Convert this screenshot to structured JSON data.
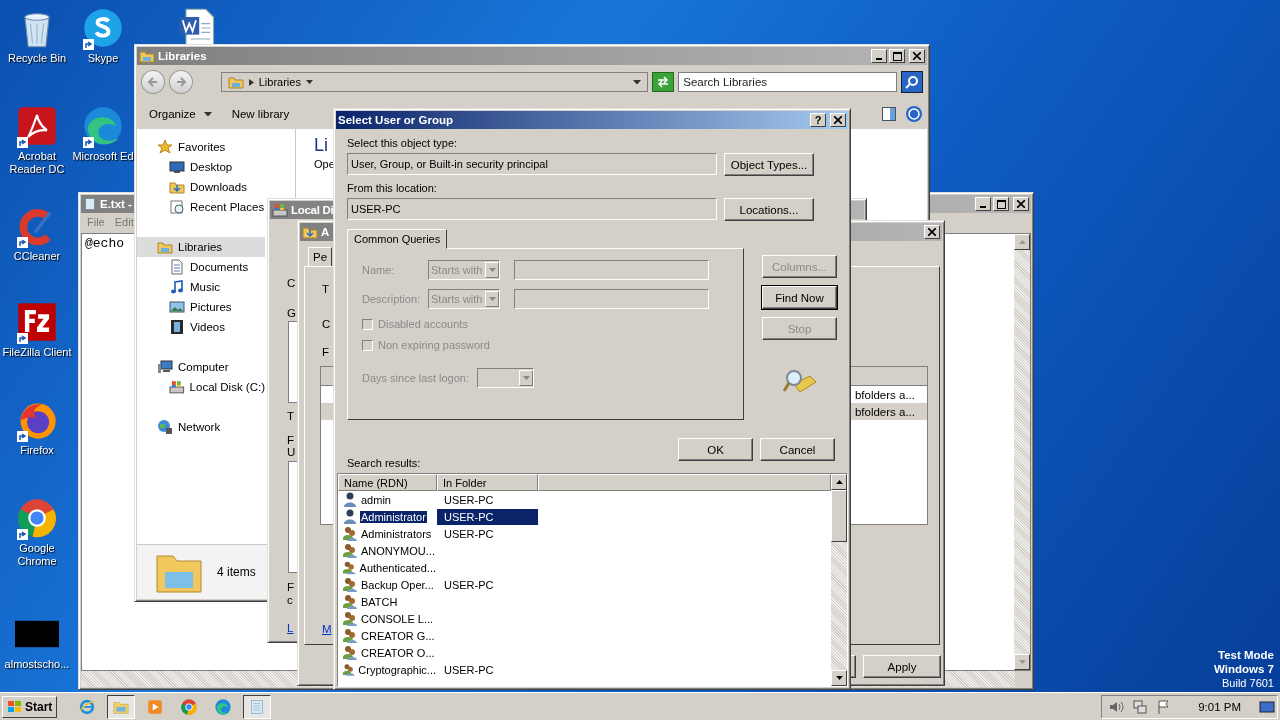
{
  "desktop_icons": [
    {
      "kind": "recycle",
      "label": "Recycle Bin",
      "shortcut": false
    },
    {
      "kind": "skype",
      "label": "Skype",
      "shortcut": true
    },
    {
      "kind": "word",
      "shortcut": false
    },
    {
      "kind": "acrobat",
      "label": "Acrobat Reader DC",
      "shortcut": true
    },
    {
      "kind": "edge",
      "label": "Microsoft Ed",
      "shortcut": true
    },
    {
      "kind": "ccleaner",
      "label": "CCleaner",
      "shortcut": true
    },
    {
      "kind": "filezilla",
      "label": "FileZilla Client",
      "shortcut": true
    },
    {
      "kind": "firefox",
      "label": "Firefox",
      "shortcut": true
    },
    {
      "kind": "chrome",
      "label": "Google Chrome",
      "shortcut": true
    },
    {
      "kind": "thumb",
      "label": "almostscho...",
      "shortcut": false
    }
  ],
  "notepad": {
    "title": "E.txt -",
    "menu": [
      "File",
      "Edit"
    ],
    "text": "@echo"
  },
  "explorer": {
    "title": "Libraries",
    "breadcrumb": "Libraries",
    "search": {
      "placeholder": "Search Libraries"
    },
    "toolbar": [
      {
        "label": "Organize",
        "dropdown": true
      },
      {
        "label": "New library",
        "dropdown": false
      }
    ],
    "nav": [
      {
        "label": "Favorites",
        "kind": "star",
        "selected": false,
        "children": [
          {
            "label": "Desktop",
            "kind": "desktop",
            "selected": false
          },
          {
            "label": "Downloads",
            "kind": "downloads",
            "selected": false
          },
          {
            "label": "Recent Places",
            "kind": "recent",
            "selected": false
          }
        ]
      },
      {
        "label": "Libraries",
        "kind": "library",
        "selected": true,
        "children": [
          {
            "label": "Documents",
            "kind": "document",
            "selected": false
          },
          {
            "label": "Music",
            "kind": "music",
            "selected": false
          },
          {
            "label": "Pictures",
            "kind": "pictures",
            "selected": false
          },
          {
            "label": "Videos",
            "kind": "videos",
            "selected": false
          }
        ]
      },
      {
        "label": "Computer",
        "kind": "computer",
        "selected": false,
        "children": [
          {
            "label": "Local Disk (C:)",
            "kind": "disk",
            "selected": false
          }
        ]
      },
      {
        "label": "Network",
        "kind": "network",
        "selected": false
      }
    ],
    "heading": "Li",
    "subheading": "Ope",
    "status": "4 items"
  },
  "local_disk_window": {
    "title": "Local Di",
    "fragments": [
      "C",
      "G",
      "T",
      "F",
      "U",
      "F",
      "c",
      "L"
    ]
  },
  "security_window": {
    "title": "A",
    "tab": "Pe",
    "fragments": [
      "T",
      "C",
      "F",
      "M"
    ],
    "list_rows": [
      {
        "text": "bfolders a...",
        "selected": false
      },
      {
        "text": "bfolders a...",
        "selected": true
      }
    ],
    "apply": "Apply"
  },
  "dialog": {
    "title": "Select User or Group",
    "help": "?",
    "object_type_label": "Select this object type:",
    "object_type": "User, Group, or Built-in security principal",
    "object_types_button": "Object Types...",
    "location_label": "From this location:",
    "location": "USER-PC",
    "locations_button": "Locations...",
    "tab": "Common Queries",
    "queries": {
      "disabled": true,
      "name_label": "Name:",
      "name_mode": "Starts with",
      "description_label": "Description:",
      "description_mode": "Starts with",
      "checkboxes": [
        {
          "label": "Disabled accounts",
          "checked": false
        },
        {
          "label": "Non expiring password",
          "checked": false
        }
      ],
      "days_label": "Days since last logon:"
    },
    "side_buttons": [
      {
        "label": "Columns...",
        "disabled": true,
        "default": false
      },
      {
        "label": "Find Now",
        "disabled": false,
        "default": true
      },
      {
        "label": "Stop",
        "disabled": true,
        "default": false
      }
    ],
    "ok": "OK",
    "cancel": "Cancel",
    "results_label": "Search results:",
    "columns": [
      "Name (RDN)",
      "In Folder"
    ],
    "rows": [
      {
        "name": "admin",
        "folder": "USER-PC",
        "kind": "user",
        "selected": false
      },
      {
        "name": "Administrator",
        "folder": "USER-PC",
        "kind": "user",
        "selected": true
      },
      {
        "name": "Administrators",
        "folder": "USER-PC",
        "kind": "group",
        "selected": false
      },
      {
        "name": "ANONYMOU...",
        "kind": "group",
        "selected": false
      },
      {
        "name": "Authenticated...",
        "kind": "group",
        "selected": false
      },
      {
        "name": "Backup Oper...",
        "folder": "USER-PC",
        "kind": "group",
        "selected": false
      },
      {
        "name": "BATCH",
        "kind": "group",
        "selected": false
      },
      {
        "name": "CONSOLE L...",
        "kind": "group",
        "selected": false
      },
      {
        "name": "CREATOR G...",
        "kind": "group",
        "selected": false
      },
      {
        "name": "CREATOR O...",
        "kind": "group",
        "selected": false
      },
      {
        "name": "Cryptographic...",
        "folder": "USER-PC",
        "kind": "group",
        "selected": false
      }
    ]
  },
  "system_notice": [
    "Test Mode",
    "Windows 7",
    "Build 7601"
  ],
  "taskbar": {
    "start": "Start",
    "apps": [
      {
        "kind": "ie",
        "active": false
      },
      {
        "kind": "explorer",
        "active": true
      },
      {
        "kind": "media",
        "active": false
      },
      {
        "kind": "chrome",
        "active": false
      },
      {
        "kind": "edge",
        "active": false
      },
      {
        "kind": "notepad",
        "active": true
      }
    ],
    "clock": "9:01 PM"
  }
}
